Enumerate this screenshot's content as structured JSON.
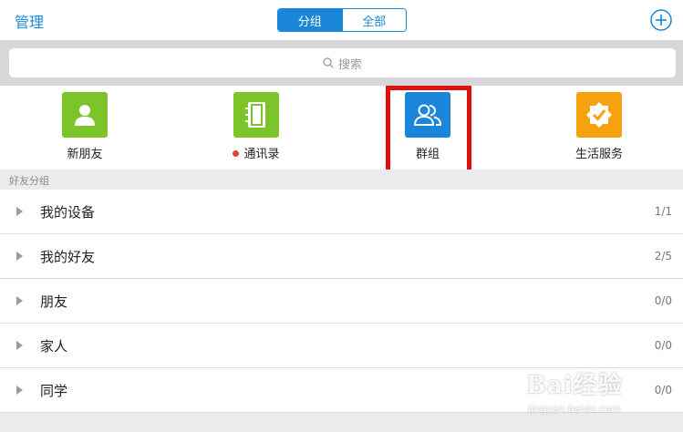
{
  "header": {
    "manage_label": "管理",
    "tabs": [
      {
        "label": "分组",
        "active": true
      },
      {
        "label": "全部",
        "active": false
      }
    ],
    "add_icon": "plus-circle-icon"
  },
  "search": {
    "placeholder": "搜索",
    "icon": "search-icon"
  },
  "entries": [
    {
      "label": "新朋友",
      "color": "#7cc42a",
      "icon": "person-icon"
    },
    {
      "label": "通讯录",
      "color": "#7cc42a",
      "icon": "notebook-icon",
      "dot_color": "#e8412e"
    },
    {
      "label": "群组",
      "color": "#1a86d9",
      "icon": "group-icon",
      "highlighted": true,
      "highlight_color": "#e01010"
    },
    {
      "label": "生活服务",
      "color": "#f5a20c",
      "icon": "verified-badge-icon"
    }
  ],
  "section": {
    "title": "好友分组"
  },
  "groups": [
    {
      "name": "我的设备",
      "count": "1/1"
    },
    {
      "name": "我的好友",
      "count": "2/5"
    },
    {
      "name": "朋友",
      "count": "0/0"
    },
    {
      "name": "家人",
      "count": "0/0"
    },
    {
      "name": "同学",
      "count": "0/0"
    }
  ],
  "watermark": {
    "main": "Bai经验",
    "sub": "jingyan.baidu.com"
  },
  "colors": {
    "accent": "#1a86d9",
    "highlight": "#e01010"
  }
}
